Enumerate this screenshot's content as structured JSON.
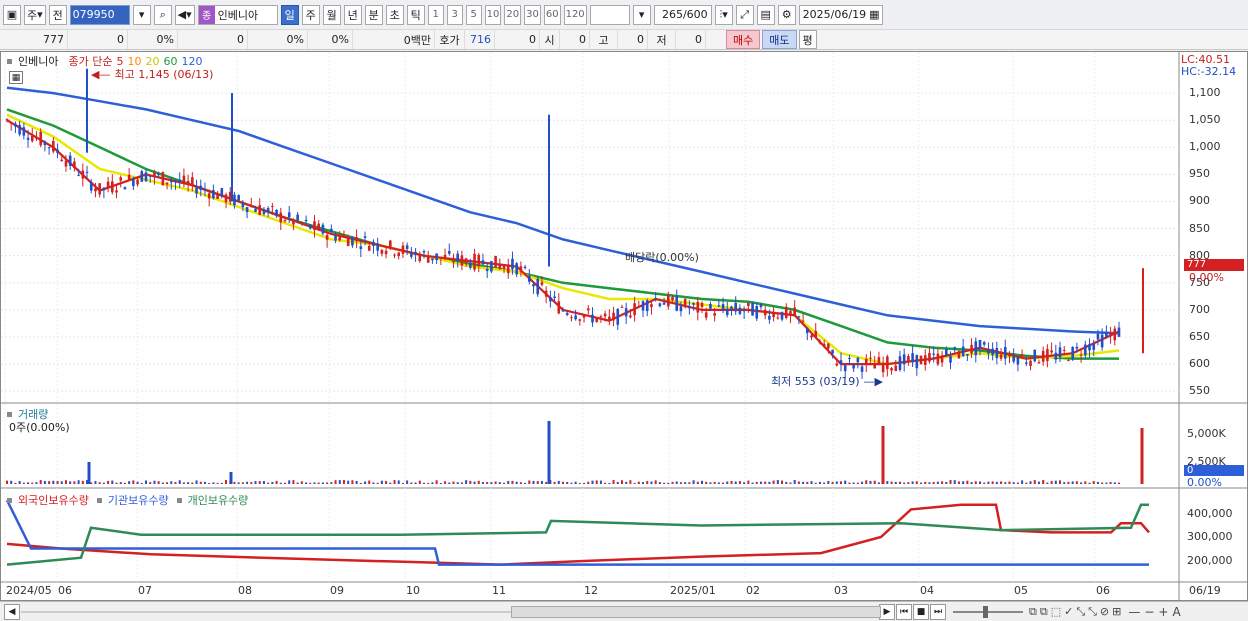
{
  "toolbar": {
    "period_button": "주",
    "prev_button": "전",
    "code_value": "079950",
    "stock_name_marker": "종",
    "stock_name": "인베니아",
    "period_tabs": [
      "일",
      "주",
      "월",
      "년",
      "분",
      "초",
      "틱"
    ],
    "active_tab": "일",
    "interval_buttons": [
      "1",
      "3",
      "5",
      "10",
      "20",
      "30",
      "60",
      "120"
    ],
    "count_value": "265",
    "count_max": "/600",
    "date_value": "2025/06/19"
  },
  "quote_bar": {
    "price": "777",
    "change": "0",
    "change_pct": "0%",
    "val1": "0",
    "val1_pct": "0%",
    "val2_pct": "0%",
    "amount": "0백만",
    "ask_label": "호가",
    "ask_value": "716",
    "bid_value": "0",
    "open_label": "시",
    "open_value": "0",
    "high_label": "고",
    "high_value": "0",
    "low_label": "저",
    "low_value": "0",
    "buy_button": "매수",
    "sell_button": "매도",
    "avg_button": "평"
  },
  "price_pane": {
    "stock_label": "인베니아",
    "ma_label": "종가 단순",
    "ma_periods": [
      "5",
      "10",
      "20",
      "60",
      "120"
    ],
    "ma_colors": [
      "#d42020",
      "#ff8c00",
      "#e8e800",
      "#1e9a3a",
      "#2f5fd8"
    ],
    "max_annotation": "최고 1,145 (06/13)",
    "min_annotation": "최저 553 (03/19)",
    "dividend_annotation": "배당락(0.00%)",
    "lc_label": "LC:40.51",
    "hc_label": "HC:-32.14",
    "current_price_tag": "777",
    "current_pct_tag": "0.00%",
    "y_ticks": [
      "1,100",
      "1,050",
      "1,000",
      "950",
      "900",
      "850",
      "800",
      "750",
      "700",
      "650",
      "600",
      "550"
    ]
  },
  "volume_pane": {
    "title": "거래량",
    "value": "0주(0.00%)",
    "y_ticks": [
      "5,000K",
      "2,500K"
    ],
    "current_tag": "0",
    "current_pct": "0.00%"
  },
  "holdings_pane": {
    "series": [
      "외국인보유수량",
      "기관보유수량",
      "개인보유수량"
    ],
    "series_colors": [
      "#d42020",
      "#2f5fd8",
      "#2e8b57"
    ],
    "y_ticks": [
      "400,000",
      "300,000",
      "200,000"
    ]
  },
  "x_axis": {
    "labels": [
      "2024/05",
      "06",
      "07",
      "08",
      "09",
      "10",
      "11",
      "12",
      "2025/01",
      "02",
      "03",
      "04",
      "05",
      "06"
    ],
    "right_label": "06/19"
  },
  "chart_data": {
    "type": "candlestick",
    "price_series": {
      "ma5_approx": [
        1050,
        1000,
        920,
        950,
        930,
        900,
        870,
        840,
        820,
        800,
        790,
        780,
        700,
        680,
        720,
        700,
        700,
        690,
        600,
        600,
        610,
        630,
        610,
        620,
        660
      ],
      "ma20_approx": [
        1060,
        1020,
        960,
        940,
        920,
        890,
        860,
        830,
        820,
        800,
        780,
        770,
        740,
        720,
        720,
        710,
        700,
        690,
        620,
        600,
        610,
        620,
        610,
        615,
        625
      ],
      "ma60_approx": [
        1070,
        1040,
        1000,
        960,
        930,
        900,
        870,
        845,
        820,
        800,
        785,
        770,
        750,
        740,
        730,
        720,
        715,
        700,
        670,
        640,
        630,
        625,
        615,
        610,
        610
      ],
      "ma120_approx": [
        1110,
        1100,
        1085,
        1070,
        1050,
        1030,
        1000,
        970,
        940,
        910,
        880,
        860,
        830,
        810,
        790,
        770,
        750,
        730,
        710,
        690,
        680,
        670,
        665,
        660,
        657
      ]
    },
    "y_range": [
      530,
      1150
    ],
    "max_price": 1145,
    "min_price": 553,
    "last_price": 777
  }
}
